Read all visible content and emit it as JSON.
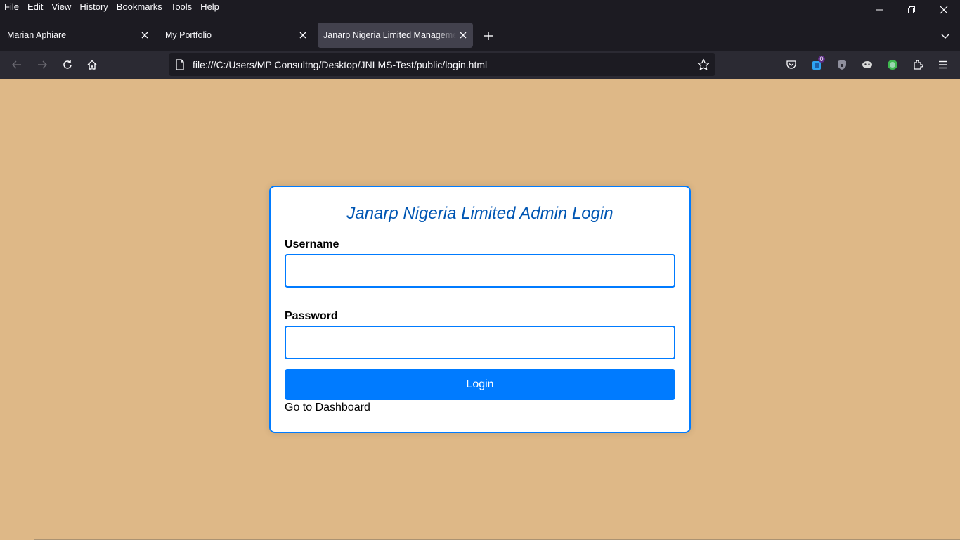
{
  "menu": {
    "items": [
      {
        "accel": "F",
        "rest": "ile"
      },
      {
        "accel": "E",
        "rest": "dit"
      },
      {
        "accel": "V",
        "rest": "iew"
      },
      {
        "accel": "s",
        "pre": "Hi",
        "rest": "tory"
      },
      {
        "accel": "B",
        "rest": "ookmarks"
      },
      {
        "accel": "T",
        "rest": "ools"
      },
      {
        "accel": "H",
        "rest": "elp"
      }
    ]
  },
  "tabs": [
    {
      "title": "Marian Aphiare",
      "active": false
    },
    {
      "title": "My Portfolio",
      "active": false
    },
    {
      "title": "Janarp Nigeria Limited Management",
      "active": true
    }
  ],
  "urlbar": {
    "url": "file:///C:/Users/MP Consultng/Desktop/JNLMS-Test/public/login.html"
  },
  "toolbar": {
    "extension_badge": "0"
  },
  "login": {
    "title": "Janarp Nigeria Limited Admin Login",
    "username_label": "Username",
    "username_value": "",
    "password_label": "Password",
    "password_value": "",
    "button_label": "Login",
    "dashboard_link": "Go to Dashboard"
  },
  "colors": {
    "page_background": "#deb887",
    "accent": "#007bff",
    "title_color": "#0056b3",
    "browser_chrome": "#1c1b22",
    "active_tab": "#42414d"
  }
}
